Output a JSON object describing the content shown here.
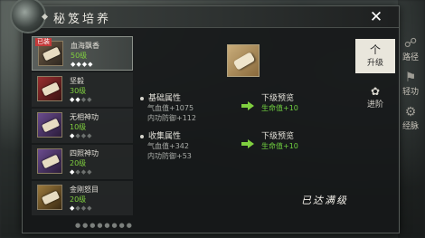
{
  "background": {
    "top_faded_text": "",
    "side_icons": [
      {
        "icon": "path-icon",
        "label": "路径"
      },
      {
        "icon": "bag-icon",
        "label": "轻功"
      },
      {
        "icon": "gear-icon",
        "label": "经脉"
      }
    ]
  },
  "window": {
    "title": "秘笈培养",
    "close_glyph": "✕"
  },
  "list": {
    "items": [
      {
        "name": "血海飘香",
        "level": "50级",
        "badge": "已装",
        "stars_on": 4,
        "stars_total": 4,
        "icon": "scroll-icon",
        "color": "default",
        "selected": true
      },
      {
        "name": "坚毅",
        "level": "30级",
        "badge": "",
        "stars_on": 2,
        "stars_total": 4,
        "icon": "scroll-icon",
        "color": "red",
        "selected": false
      },
      {
        "name": "无相神功",
        "level": "10级",
        "badge": "",
        "stars_on": 1,
        "stars_total": 4,
        "icon": "scroll-icon",
        "color": "purple",
        "selected": false
      },
      {
        "name": "四照神功",
        "level": "20级",
        "badge": "",
        "stars_on": 1,
        "stars_total": 4,
        "icon": "scroll-icon",
        "color": "purple",
        "selected": false
      },
      {
        "name": "金刚怒目",
        "level": "20级",
        "badge": "",
        "stars_on": 1,
        "stars_total": 4,
        "icon": "scroll-icon",
        "color": "gold",
        "selected": false
      }
    ],
    "scroll_dots": "●●●●●●●●"
  },
  "detail": {
    "item_icon": "scroll-icon",
    "basic": {
      "header": "基础属性",
      "lines": [
        "气血值+1075",
        "内功防御+112"
      ],
      "preview_header": "下级预览",
      "preview_value": "生命值+10"
    },
    "collect": {
      "header": "收集属性",
      "lines": [
        "气血值+342",
        "内功防御+53"
      ],
      "preview_header": "下级预览",
      "preview_value": "生命值+10"
    },
    "maxed_text": "已达满级"
  },
  "tabs": [
    {
      "icon": "upgrade-icon",
      "glyph": "个",
      "label": "升级",
      "active": true
    },
    {
      "icon": "advance-icon",
      "glyph": "✿",
      "label": "进阶",
      "active": false
    }
  ],
  "colors": {
    "level_green": "#7fcf3f",
    "preview_green": "#6fcf3f",
    "badge_red": "#c43a3a",
    "tab_active_bg": "#e9e6dc"
  }
}
